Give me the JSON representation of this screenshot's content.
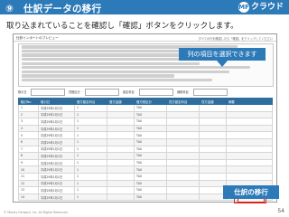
{
  "header": {
    "title": "⑨　仕訳データの移行",
    "logo_mark": "MF",
    "logo_text": "クラウド"
  },
  "instruction": "取り込まれていることを確認し「確認」ボタンをクリックします。",
  "screenshot": {
    "title": "仕訳インポートのプレビュー",
    "hint": "すべての行を確認したら「確認」をクリックしてください",
    "filters": [
      {
        "label": "取引日"
      },
      {
        "label": "貸借区分"
      },
      {
        "label": "勘定科目"
      },
      {
        "label": "補助科目"
      }
    ],
    "table": {
      "columns": [
        "取引No",
        "取引日",
        "借方勘定科目",
        "借方金額",
        "借方税区分",
        "貸方勘定科目",
        "貸方金額",
        "摘要"
      ],
      "rows": [
        [
          "1",
          "平成29年1月1日",
          "1",
          "",
          "TAX",
          "",
          "",
          ""
        ],
        [
          "2",
          "平成29年1月1日",
          "1",
          "",
          "TAX",
          "",
          "",
          ""
        ],
        [
          "3",
          "平成29年1月1日",
          "1",
          "",
          "TAX",
          "",
          "",
          ""
        ],
        [
          "4",
          "平成29年1月1日",
          "1",
          "",
          "TAX",
          "",
          "",
          ""
        ],
        [
          "5",
          "平成29年1月1日",
          "1",
          "",
          "TAX",
          "",
          "",
          ""
        ],
        [
          "6",
          "平成29年1月1日",
          "1",
          "",
          "TAX",
          "",
          "",
          ""
        ],
        [
          "7",
          "平成29年1月1日",
          "1",
          "",
          "TAX",
          "",
          "",
          ""
        ],
        [
          "8",
          "平成29年1月1日",
          "1",
          "",
          "TAX",
          "",
          "",
          ""
        ],
        [
          "9",
          "平成29年1月1日",
          "1",
          "",
          "TAX",
          "",
          "",
          ""
        ],
        [
          "10",
          "平成29年1月1日",
          "1",
          "",
          "TAX",
          "",
          "",
          ""
        ],
        [
          "11",
          "平成29年1月1日",
          "1",
          "",
          "TAX",
          "",
          "",
          ""
        ],
        [
          "12",
          "平成29年1月1日",
          "1",
          "",
          "TAX",
          "",
          "",
          ""
        ],
        [
          "13",
          "平成29年1月1日",
          "1",
          "",
          "TAX",
          "",
          "",
          ""
        ],
        [
          "14",
          "平成29年1月1日",
          "1",
          "",
          "TAX",
          "",
          "",
          ""
        ]
      ]
    },
    "confirm_label": "確認"
  },
  "callout": "列の項目を選択できます",
  "tag": "仕訳の移行",
  "footer": "© Money Forward, Inc. All Rights Reserved.",
  "page_number": "54",
  "colors": {
    "primary": "#2d7ab9",
    "table_header": "#2d6e9e",
    "highlight": "#d9261c"
  }
}
